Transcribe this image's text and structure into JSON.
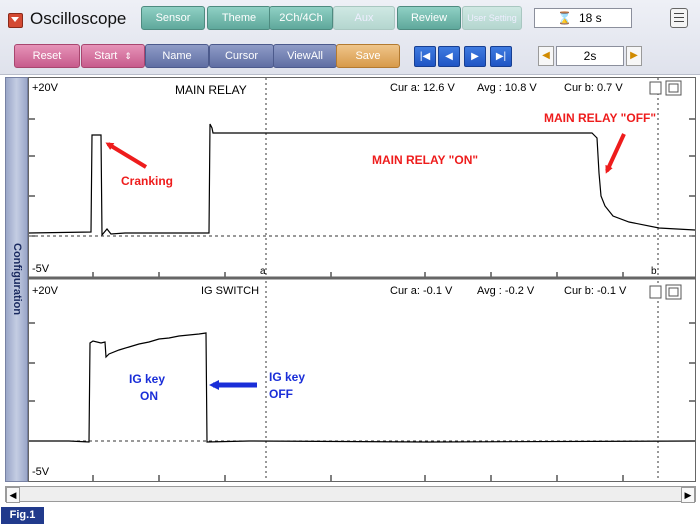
{
  "toolbar": {
    "title": "Oscilloscope",
    "tabs": [
      {
        "label": "Sensor",
        "enabled": true
      },
      {
        "label": "Theme",
        "enabled": true
      },
      {
        "label": "2Ch/4Ch",
        "enabled": true
      },
      {
        "label": "Aux",
        "enabled": false
      },
      {
        "label": "Review",
        "enabled": true
      },
      {
        "label": "User Setting",
        "enabled": false
      }
    ],
    "timer": "18 s",
    "buttons": {
      "reset": "Reset",
      "start": "Start",
      "name": "Name",
      "cursor": "Cursor",
      "viewall": "ViewAll",
      "save": "Save"
    },
    "time_div": "2s"
  },
  "sidebar": {
    "label": "Configuration"
  },
  "channel1": {
    "name": "MAIN RELAY",
    "top_label": "+20V",
    "bottom_label": "-5V",
    "cur_a": "Cur a:  12.6 V",
    "avg": "Avg  :  10.8 V",
    "cur_b": "Cur b:  0.7 V",
    "cursor_a_label": "a",
    "cursor_b_label": "b",
    "annotations": {
      "cranking": "Cranking",
      "relay_on": "MAIN RELAY \"ON\"",
      "relay_off": "MAIN RELAY \"OFF\""
    }
  },
  "channel2": {
    "name": "IG SWITCH",
    "top_label": "+20V",
    "bottom_label": "-5V",
    "cur_a": "Cur a:  -0.1 V",
    "avg": "Avg  :  -0.2 V",
    "cur_b": "Cur b:  -0.1 V",
    "annotations": {
      "ig_on_1": "IG key",
      "ig_on_2": "ON",
      "ig_off_1": "IG key",
      "ig_off_2": "OFF"
    }
  },
  "figure_label": "Fig.1",
  "colors": {
    "annotation_red": "#ee1c1c",
    "annotation_blue": "#1a2ed8",
    "tab_teal": "#6fb3a7"
  }
}
